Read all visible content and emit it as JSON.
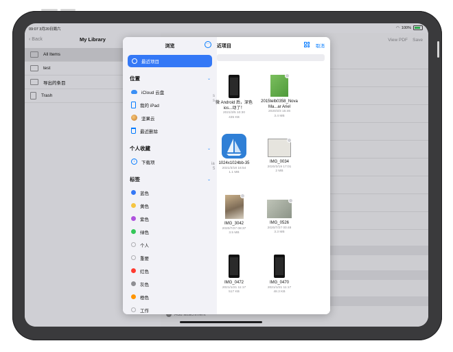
{
  "status": {
    "time": "09:07  3月20日周六",
    "battery": "100%"
  },
  "app": {
    "back": "Back",
    "library_title": "My Library",
    "library_items": [
      {
        "label": "All Items",
        "selected": true
      },
      {
        "label": "test",
        "selected": false
      },
      {
        "label": "导出的条目",
        "selected": false
      },
      {
        "label": "Trash",
        "selected": false
      }
    ],
    "view_pdf": "View PDF",
    "save": "Save",
    "add_attachment": "Add attachment"
  },
  "browse": {
    "title": "浏览",
    "recent": "最近项目",
    "locations_header": "位置",
    "locations": [
      {
        "label": "iCloud 云盘",
        "icon": "cloud-icon"
      },
      {
        "label": "我的 iPad",
        "icon": "ipad-icon"
      },
      {
        "label": "坚果云",
        "icon": "jianguoyun-icon"
      },
      {
        "label": "最近删除",
        "icon": "trash-icon"
      }
    ],
    "favorites_header": "个人收藏",
    "favorites": [
      {
        "label": "下载项",
        "icon": "download-icon"
      }
    ],
    "tags_header": "标签",
    "tags": [
      {
        "label": "蓝色",
        "color": "#3478f6"
      },
      {
        "label": "黄色",
        "color": "#f5c542"
      },
      {
        "label": "紫色",
        "color": "#af52de"
      },
      {
        "label": "绿色",
        "color": "#34c759"
      },
      {
        "label": "个人",
        "color": ""
      },
      {
        "label": "重要",
        "color": ""
      },
      {
        "label": "红色",
        "color": "#ff3b30"
      },
      {
        "label": "灰色",
        "color": "#8e8e93"
      },
      {
        "label": "橙色",
        "color": "#ff9500"
      },
      {
        "label": "工作",
        "color": ""
      }
    ]
  },
  "files": {
    "title": "近项目",
    "cancel": "取消",
    "ghost_text": [
      "s",
      "s",
      "ia",
      "5"
    ],
    "items": [
      {
        "name": "微 Android 后，深色 ios...动了！",
        "date": "2021/3/5 10:30",
        "size": "435 KB",
        "thumb": "phone-screenshot"
      },
      {
        "name": "2015telb0358_Nova Ma...ar Ariel",
        "date": "2020/3/3 15:46",
        "size": "3.4 MB",
        "thumb": "doc-green"
      },
      {
        "name": "1024x1024bb-35",
        "date": "2021/3/18 16:54",
        "size": "1.1 MB",
        "thumb": "app-icon-sailboat"
      },
      {
        "name": "IMG_0034",
        "date": "2020/3/19 17:01",
        "size": "2 MB",
        "thumb": "photo-document"
      },
      {
        "name": "IMG_3042",
        "date": "2020/7/27 08:37",
        "size": "3.5 MB",
        "thumb": "photo-collage"
      },
      {
        "name": "IMG_0526",
        "date": "2020/7/27 00:48",
        "size": "3.3 MB",
        "thumb": "photo-paper"
      },
      {
        "name": "IMG_0472",
        "date": "2021/1/21 11:17",
        "size": "517 KB",
        "thumb": "phone-screenshot"
      },
      {
        "name": "IMG_0470",
        "date": "2021/1/21 11:17",
        "size": "48.3 KB",
        "thumb": "phone-screenshot"
      }
    ]
  }
}
